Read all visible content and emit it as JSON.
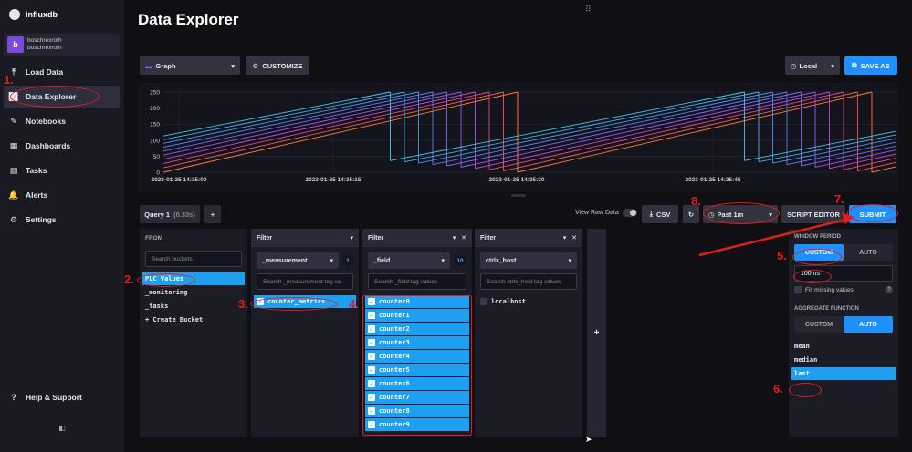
{
  "app": {
    "name": "influxdb"
  },
  "user": {
    "avatar": "b",
    "name1": "boschrexroth",
    "name2": "boschrexroth"
  },
  "nav": [
    {
      "label": "Load Data",
      "icon": "upload-icon"
    },
    {
      "label": "Data Explorer",
      "icon": "graph-icon"
    },
    {
      "label": "Notebooks",
      "icon": "pencil-icon"
    },
    {
      "label": "Dashboards",
      "icon": "grid-icon"
    },
    {
      "label": "Tasks",
      "icon": "calendar-icon"
    },
    {
      "label": "Alerts",
      "icon": "bell-icon"
    },
    {
      "label": "Settings",
      "icon": "gear-icon"
    }
  ],
  "help": "Help & Support",
  "page": {
    "title": "Data Explorer"
  },
  "toolbar": {
    "graph_type": "Graph",
    "customize": "CUSTOMIZE",
    "timezone": "Local",
    "save_as": "SAVE AS"
  },
  "chart_data": {
    "type": "line",
    "yticks": [
      "250",
      "200",
      "150",
      "100",
      "50",
      "0"
    ],
    "ylim": [
      0,
      250
    ],
    "xticks": [
      "2023-01-25 14:35:00",
      "2023-01-25 14:35:15",
      "2023-01-25 14:35:30",
      "2023-01-25 14:35:45"
    ],
    "series_colors": [
      "#ff7a3d",
      "#f25a5a",
      "#e04a8a",
      "#c14bd6",
      "#9a5af0",
      "#7a6cf5",
      "#5a7ef5",
      "#4a94f2",
      "#46aef0",
      "#4ac4ee"
    ]
  },
  "query": {
    "tab": "Query 1",
    "time": "(0.33s)",
    "add": "+",
    "view_raw": "View Raw Data",
    "csv": "CSV",
    "range": "Past 1m",
    "script_editor": "SCRIPT EDITOR",
    "submit": "SUBMIT"
  },
  "from": {
    "header": "FROM",
    "search": "Search buckets",
    "buckets": [
      "PLC Values",
      "_monitoring",
      "_tasks",
      "+ Create Bucket"
    ]
  },
  "filter1": {
    "header": "Filter",
    "key": "_measurement",
    "count": "1",
    "search": "Search _measurement tag va",
    "values": [
      "counter_metrics"
    ]
  },
  "filter2": {
    "header": "Filter",
    "key": "_field",
    "count": "10",
    "search": "Search _field tag values",
    "values": [
      "counter0",
      "counter1",
      "counter2",
      "counter3",
      "counter4",
      "counter5",
      "counter6",
      "counter7",
      "counter8",
      "counter9"
    ]
  },
  "filter3": {
    "header": "Filter",
    "key": "ctrlx_host",
    "search": "Search ctrlx_host tag values",
    "values": [
      "localhost"
    ]
  },
  "window": {
    "label": "WINDOW PERIOD",
    "custom": "CUSTOM",
    "auto": "AUTO",
    "value": "100ms",
    "fill": "Fill missing values",
    "agg_label": "AGGREGATE FUNCTION",
    "agg_custom": "CUSTOM",
    "agg_auto": "AUTO",
    "functions": [
      "mean",
      "median",
      "last"
    ]
  },
  "annotations": [
    "1.",
    "2.",
    "3.",
    "4.",
    "5.",
    "6.",
    "7.",
    "8."
  ]
}
